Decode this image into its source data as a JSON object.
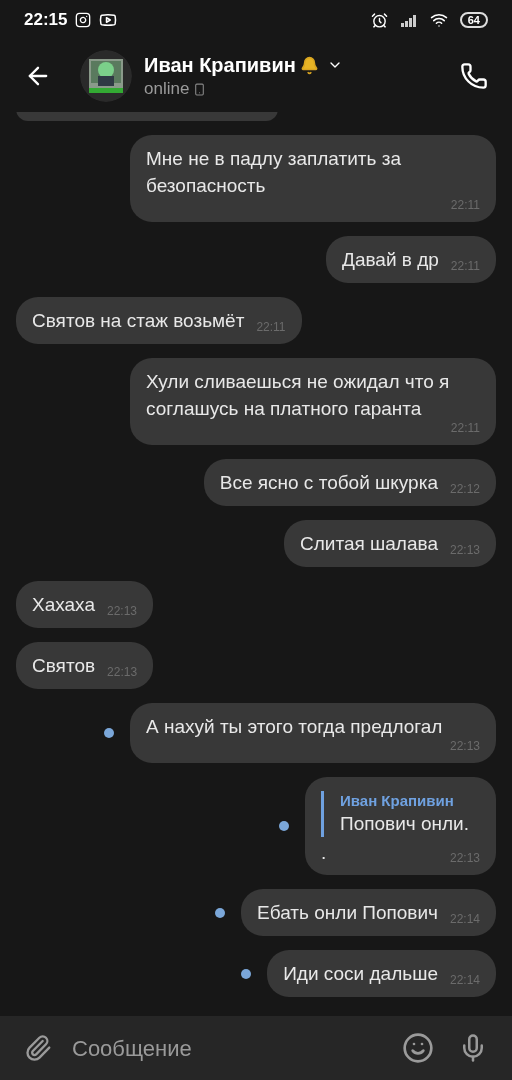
{
  "status_bar": {
    "time": "22:15",
    "battery": "64"
  },
  "header": {
    "name": "Иван Крапивин",
    "muted_bell": true,
    "status": "online"
  },
  "messages": [
    {
      "outgoing": false,
      "kind": "partial"
    },
    {
      "outgoing": true,
      "kind": "text",
      "text": "Мне не в падлу заплатить за безопасность",
      "time": "22:11",
      "unread": false
    },
    {
      "outgoing": true,
      "kind": "text",
      "text": "Давай в др",
      "time": "22:11",
      "unread": false
    },
    {
      "outgoing": false,
      "kind": "text",
      "text": "Святов на стаж возьмёт",
      "time": "22:11"
    },
    {
      "outgoing": true,
      "kind": "text",
      "text": "Хули сливаешься не ожидал что я соглашусь на платного гаранта",
      "time": "22:11",
      "unread": false
    },
    {
      "outgoing": true,
      "kind": "text",
      "text": "Все ясно с тобой шкурка",
      "time": "22:12",
      "unread": false
    },
    {
      "outgoing": true,
      "kind": "text",
      "text": "Слитая шалава",
      "time": "22:13",
      "unread": false
    },
    {
      "outgoing": false,
      "kind": "text",
      "text": "Хахаха",
      "time": "22:13"
    },
    {
      "outgoing": false,
      "kind": "text",
      "text": "Святов",
      "time": "22:13"
    },
    {
      "outgoing": true,
      "kind": "text",
      "text": "А нахуй ты этого тогда предлогал",
      "time": "22:13",
      "unread": true
    },
    {
      "outgoing": true,
      "kind": "reply",
      "reply_author": "Иван Крапивин",
      "reply_text": "Попович онли.",
      "text": ".",
      "time": "22:13",
      "unread": true
    },
    {
      "outgoing": true,
      "kind": "text",
      "text": "Ебать онли Попович",
      "time": "22:14",
      "unread": true
    },
    {
      "outgoing": true,
      "kind": "text",
      "text": "Иди соси дальше",
      "time": "22:14",
      "unread": true
    }
  ],
  "composer": {
    "placeholder": "Сообщение"
  }
}
